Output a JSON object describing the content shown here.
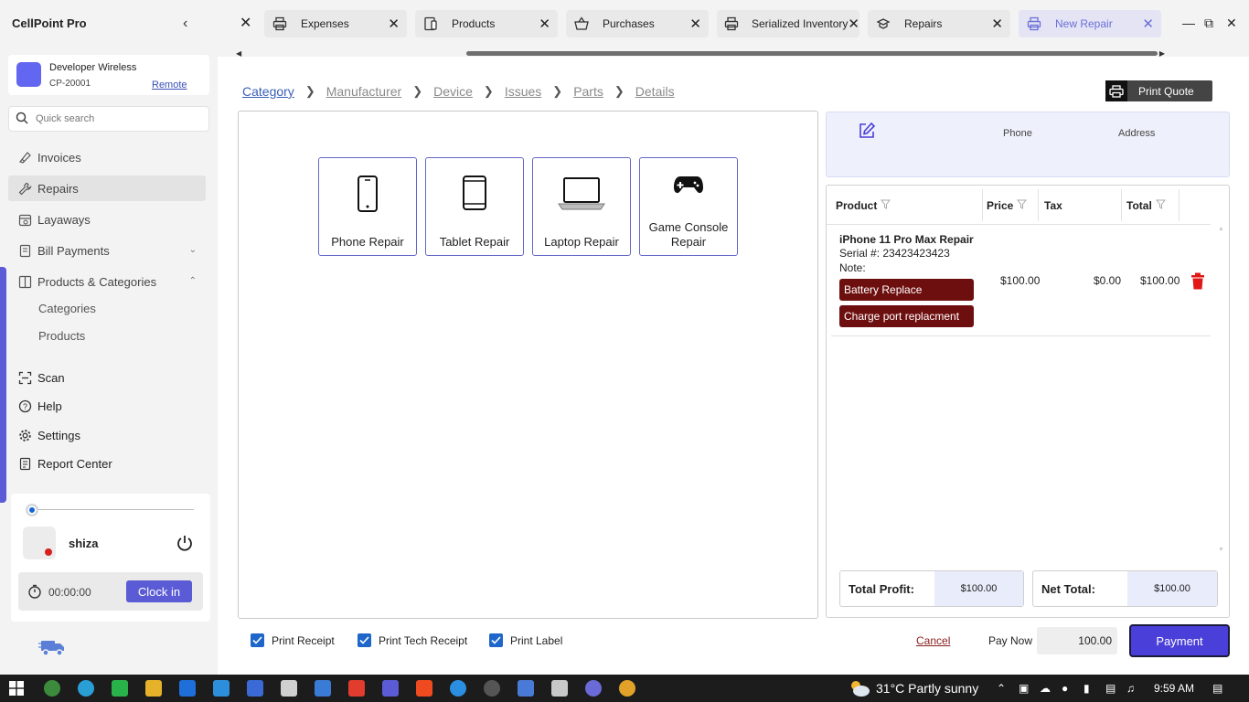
{
  "app": {
    "title": "CellPoint Pro",
    "collapse_icon": "chevron-left-icon"
  },
  "tabs": [
    {
      "label": "Expenses",
      "icon": "printer-icon",
      "active": false
    },
    {
      "label": "Products",
      "icon": "tablet-icon",
      "active": false
    },
    {
      "label": "Purchases",
      "icon": "basket-icon",
      "active": false
    },
    {
      "label": "Serialized Inventory",
      "icon": "printer-icon",
      "active": false
    },
    {
      "label": "Repairs",
      "icon": "wrench-icon",
      "active": false
    },
    {
      "label": "New Repair",
      "icon": "printer-icon",
      "active": true
    }
  ],
  "company": {
    "name": "Developer Wireless",
    "id": "CP-20001",
    "link": "Remote"
  },
  "search": {
    "placeholder": "Quick search"
  },
  "sidebar": {
    "items": [
      {
        "label": "Invoices",
        "icon": "invoice-icon"
      },
      {
        "label": "Repairs",
        "icon": "wrench-icon",
        "active": true
      },
      {
        "label": "Layaways",
        "icon": "calendar-icon"
      },
      {
        "label": "Bill Payments",
        "icon": "bill-icon",
        "expanded": false
      },
      {
        "label": "Products & Categories",
        "icon": "box-icon",
        "expanded": true
      }
    ],
    "subitems": [
      "Categories",
      "Products"
    ],
    "bottom_items": [
      {
        "label": "Scan",
        "icon": "scan-icon"
      },
      {
        "label": "Help",
        "icon": "help-icon"
      },
      {
        "label": "Settings",
        "icon": "gear-icon"
      },
      {
        "label": "Report Center",
        "icon": "report-icon"
      }
    ]
  },
  "user": {
    "name": "shiza",
    "timer": "00:00:00",
    "clockin_label": "Clock in"
  },
  "breadcrumb": [
    "Category",
    "Manufacturer",
    "Device",
    "Issues",
    "Parts",
    "Details"
  ],
  "print_quote_label": "Print Quote",
  "categories": [
    {
      "label": "Phone Repair",
      "icon": "phone-icon"
    },
    {
      "label": "Tablet Repair",
      "icon": "tablet-icon"
    },
    {
      "label": "Laptop Repair",
      "icon": "laptop-icon"
    },
    {
      "label": "Game Console Repair",
      "icon": "gamepad-icon"
    }
  ],
  "customer": {
    "phone_label": "Phone",
    "address_label": "Address"
  },
  "cart": {
    "columns": [
      "Product",
      "Price",
      "Tax",
      "Total"
    ],
    "rows": [
      {
        "product": "iPhone 11 Pro Max Repair",
        "serial": "Serial #: 23423423423",
        "note": "Note:",
        "issues": [
          "Battery Replace",
          "Charge port replacment"
        ],
        "price": "$100.00",
        "tax": "$0.00",
        "total": "$100.00"
      }
    ]
  },
  "summary": {
    "profit_label": "Total Profit:",
    "profit_value": "$100.00",
    "net_label": "Net Total:",
    "net_value": "$100.00"
  },
  "footer": {
    "options": [
      "Print Receipt",
      "Print Tech Receipt",
      "Print Label"
    ],
    "cancel_label": "Cancel",
    "paynow_label": "Pay Now",
    "paynow_value": "100.00",
    "payment_label": "Payment"
  },
  "taskbar": {
    "weather": "31°C  Partly sunny",
    "time": "9:59 AM"
  }
}
